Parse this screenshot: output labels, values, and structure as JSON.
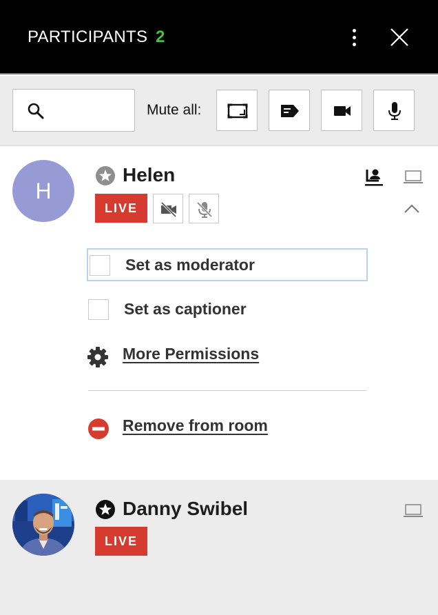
{
  "header": {
    "title": "PARTICIPANTS",
    "count": "2"
  },
  "toolbar": {
    "search_placeholder": "",
    "mute_all_label": "Mute all:"
  },
  "participants": [
    {
      "initial": "H",
      "name": "Helen",
      "status": "LIVE",
      "avatar_color": "#969bd6",
      "options": [
        {
          "label": "Set as moderator",
          "checked": false
        },
        {
          "label": "Set as captioner",
          "checked": false
        }
      ],
      "more_permissions_label": "More Permissions",
      "remove_label": "Remove from room"
    },
    {
      "name": "Danny Swibel",
      "status": "LIVE"
    }
  ],
  "colors": {
    "live": "#d63b2f",
    "count": "#4dbd3f",
    "remove": "#d63b2f"
  }
}
